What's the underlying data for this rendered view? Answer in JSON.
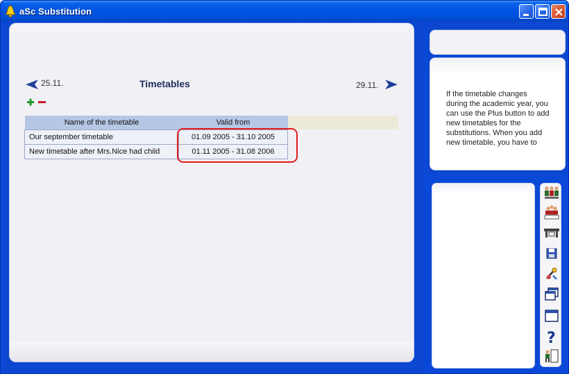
{
  "window": {
    "title": "aSc Substitution",
    "icons": {
      "app": "bell-icon",
      "minimize": "minimize-icon",
      "maximize": "maximize-icon",
      "close": "close-icon"
    }
  },
  "tabs": [
    {
      "icon": "sleeping-person-icon",
      "active": false
    },
    {
      "icon": "teachers-group-icon",
      "active": false
    },
    {
      "icon": "printer-icon",
      "active": true
    },
    {
      "icon": "bell-alert-icon",
      "active": false
    },
    {
      "icon": "teacher-desk-icon",
      "active": false
    },
    {
      "icon": "book-icon",
      "active": false
    },
    {
      "icon": "person-icon",
      "active": false
    },
    {
      "icon": "lightbulb-icon",
      "active": false
    }
  ],
  "navigation": {
    "prev_date": "25.11.",
    "next_date": "29.11.",
    "title": "Timetables",
    "arrow_color": "#1f3f9a"
  },
  "table": {
    "columns": [
      "Name of the timetable",
      "Valid from"
    ],
    "rows": [
      {
        "name": "Our september timetable",
        "valid": "01.09 2005 - 31.10 2005"
      },
      {
        "name": "New timetable after Mrs.Nice had child",
        "valid": "01.11 2005 - 31.08 2006"
      }
    ]
  },
  "help": {
    "text": "If the timetable changes during the academic year, you can use the Plus button to add new timetables for the substitutions. When you add new timetable, you have to"
  },
  "toolbar": [
    {
      "icon": "teachers-icon"
    },
    {
      "icon": "class-group-icon"
    },
    {
      "icon": "classroom-table-icon"
    },
    {
      "icon": "save-disk-icon"
    },
    {
      "icon": "tools-wizard-icon"
    },
    {
      "icon": "windows-cascade-icon"
    },
    {
      "icon": "window-icon"
    },
    {
      "icon": "help-question-icon"
    },
    {
      "icon": "exit-door-icon"
    }
  ],
  "colors": {
    "frame_blue": "#0b47d0",
    "header_blue": "#b5c7e5",
    "highlight_red": "#e21b1b",
    "plus_green": "#1f9a2a",
    "minus_red": "#c8192a"
  }
}
